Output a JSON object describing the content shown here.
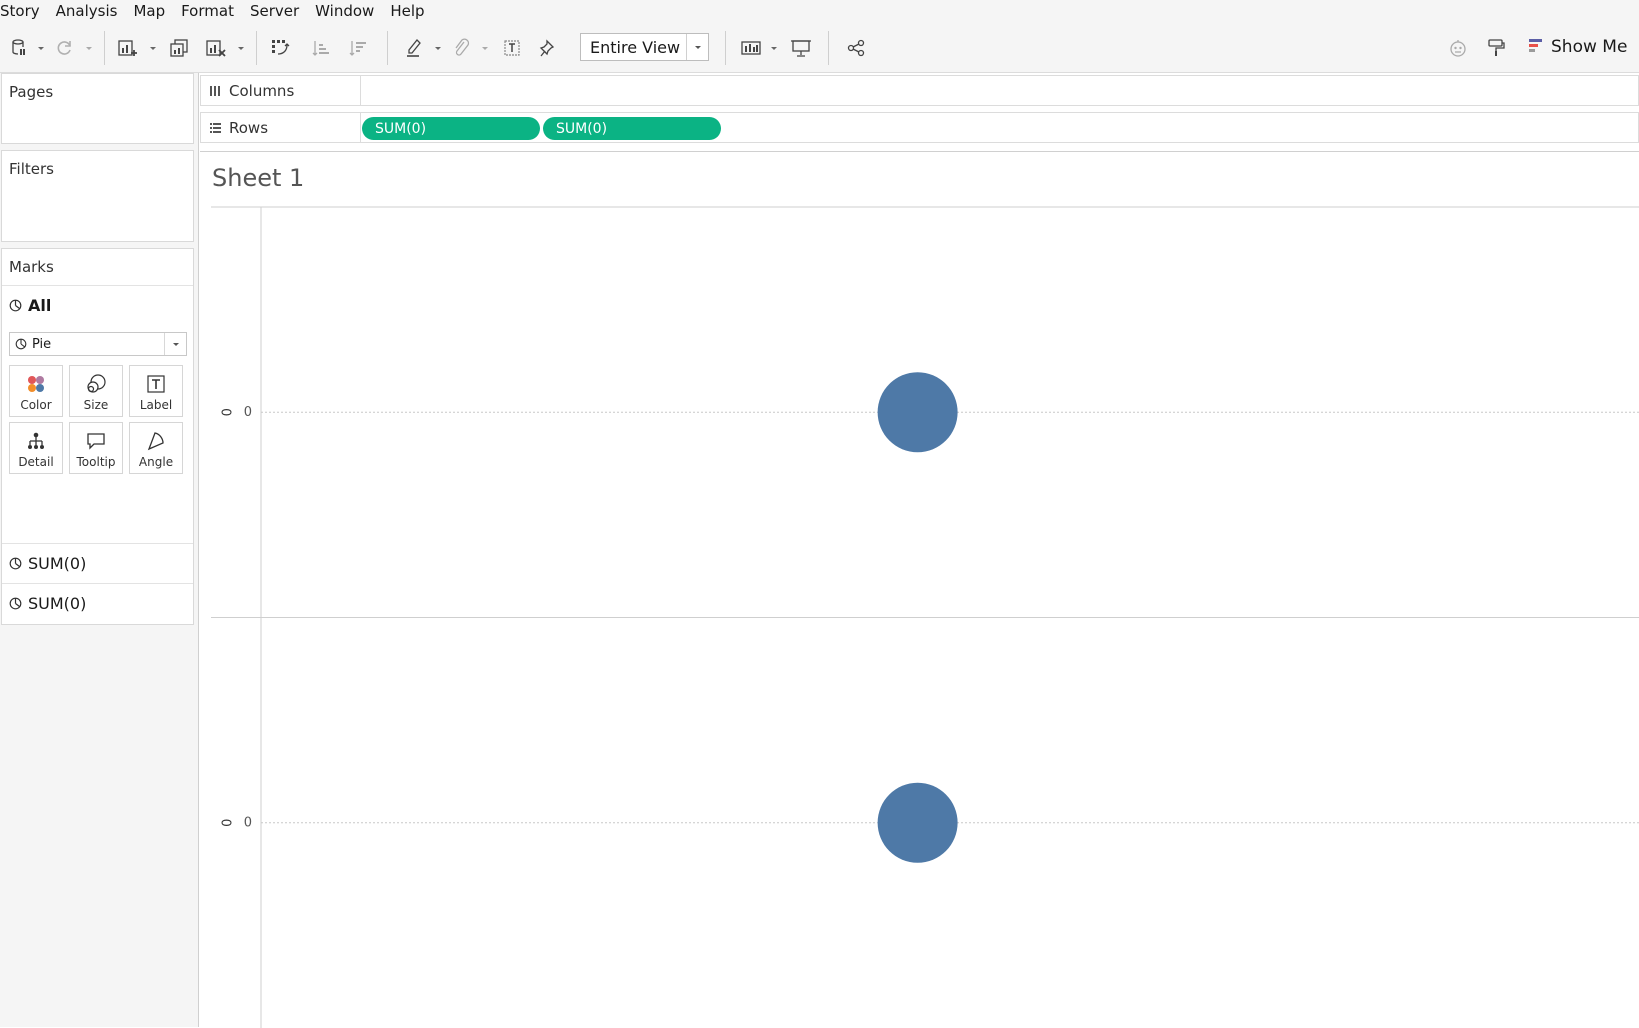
{
  "menu": {
    "items": [
      "Story",
      "Analysis",
      "Map",
      "Format",
      "Server",
      "Window",
      "Help"
    ]
  },
  "toolbar": {
    "fit_label": "Entire View",
    "show_me_label": "Show Me"
  },
  "left_panel": {
    "pages_title": "Pages",
    "filters_title": "Filters",
    "marks_title": "Marks",
    "marks_all_label": "All",
    "mark_type": "Pie",
    "mark_buttons": [
      "Color",
      "Size",
      "Label",
      "Detail",
      "Tooltip",
      "Angle"
    ],
    "measure_tabs": [
      "SUM(0)",
      "SUM(0)"
    ]
  },
  "shelves": {
    "columns_label": "Columns",
    "rows_label": "Rows",
    "row_pills": [
      "SUM(0)",
      "SUM(0)"
    ]
  },
  "sheet": {
    "title": "Sheet 1"
  },
  "chart_data": {
    "type": "pie",
    "panes": [
      {
        "axis_title": "0",
        "tick_label": "0",
        "value": 0
      },
      {
        "axis_title": "0",
        "tick_label": "0",
        "value": 0
      }
    ],
    "mark_color": "#4e79a7",
    "grid": true
  },
  "colors": {
    "pill": "#0bb384",
    "mark": "#4e79a7"
  }
}
